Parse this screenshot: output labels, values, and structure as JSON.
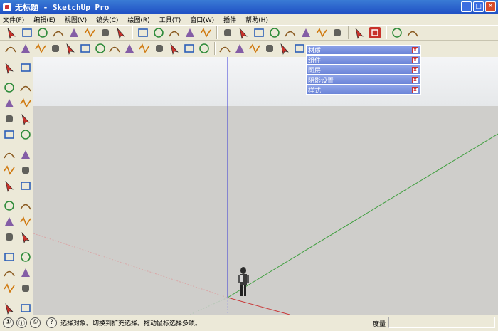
{
  "window": {
    "title": "无标题 - SketchUp Pro",
    "minimize": "_",
    "maximize": "□",
    "close": "✕"
  },
  "menu": [
    "文件(F)",
    "编辑(E)",
    "视图(V)",
    "镜头(C)",
    "绘图(R)",
    "工具(T)",
    "窗口(W)",
    "插件",
    "帮助(H)"
  ],
  "toolbar_top": [
    "select-icon",
    "move-icon",
    "rotate-icon",
    "scale-icon",
    "push-pull-icon",
    "follow-me-icon",
    "offset-icon",
    "intersect-icon",
    "eraser-icon",
    "paint-icon",
    "tape-icon",
    "dimension-icon",
    "protractor-icon",
    "axes-icon",
    "text-icon",
    "3d-text-icon",
    "section-icon",
    "camera-icon",
    "walk-icon",
    "look-icon",
    "components-icon",
    "orbit-icon",
    "su-app-icon",
    "settings-icon",
    "v-ray-icon"
  ],
  "toolbar_second": [
    "line-icon",
    "arc-icon",
    "freehand-icon",
    "curve-icon",
    "bezier-icon",
    "fillet-icon",
    "rect-icon",
    "polygon-icon",
    "spiral-icon",
    "zigzag-icon",
    "cloud-icon",
    "shape-icon",
    "bulge-icon",
    "rounded-rect-icon",
    "line2-icon",
    "circle2-icon",
    "wrench-icon",
    "arc2-icon",
    "ellipse-icon",
    "shape2-icon"
  ],
  "left_tools": [
    "select-icon",
    "eraser-icon",
    "paint-bucket-icon",
    "erase-icon",
    "rectangle-icon",
    "pencil-icon",
    "circle-icon",
    "arc-icon",
    "polygon-icon",
    "freehand-icon",
    "move-icon",
    "push-pull-icon",
    "rotate-icon",
    "follow-me-icon",
    "scale-icon",
    "offset-icon",
    "tape-measure-icon",
    "dimension-icon",
    "protractor-icon",
    "text-icon",
    "axes-icon",
    "3d-text-icon",
    "orbit-icon",
    "pan-icon",
    "zoom-icon",
    "zoom-window-icon",
    "zoom-extents-icon",
    "previous-icon",
    "walk-icon",
    "look-around-icon",
    "section-plane-icon",
    "position-camera-icon"
  ],
  "trays": [
    {
      "label": "材质"
    },
    {
      "label": "组件"
    },
    {
      "label": "图层"
    },
    {
      "label": "阴影设置"
    },
    {
      "label": "样式"
    }
  ],
  "status": {
    "text": "选择对象。切换到扩充选择。拖动鼠标选择多项。",
    "measure_label": "度量",
    "measure_value": "",
    "icon1": "①",
    "icon2": "ⓘ",
    "icon3": "©",
    "help": "?"
  },
  "colors": {
    "sky_top": "#f4f5f7",
    "sky_bottom": "#e6e8ea",
    "ground": "#cfcecb",
    "x_axis": "#c93a3a",
    "y_axis": "#3f9f3f",
    "z_axis": "#3a3ad6"
  }
}
